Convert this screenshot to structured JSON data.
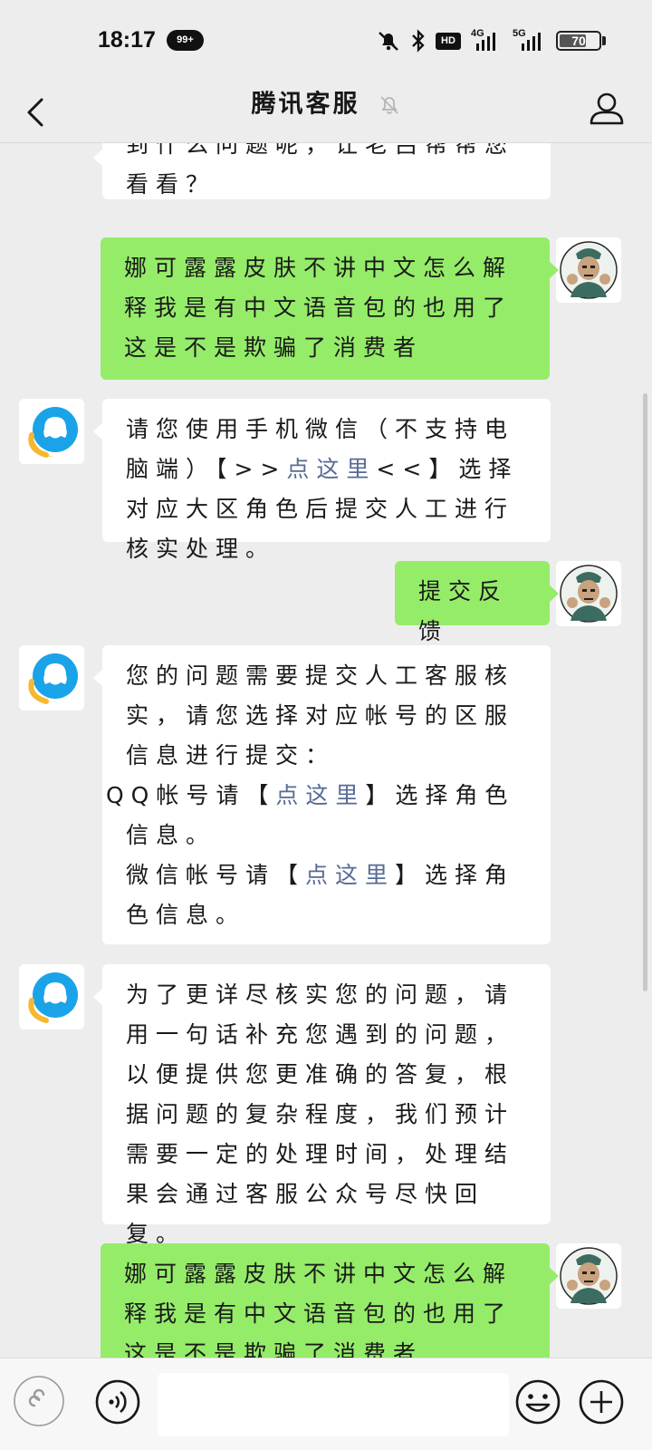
{
  "status_bar": {
    "time": "18:17",
    "notification_badge": "99+",
    "network_hd": "HD",
    "network_4g": "4G",
    "network_5g": "5G",
    "battery": "70",
    "battery_level_percent": 70
  },
  "header": {
    "title": "腾讯客服",
    "icons": {
      "back": "chevron-left-icon",
      "mute": "bell-muted-icon",
      "profile": "person-icon"
    }
  },
  "messages": [
    {
      "from": "service",
      "text": "到什么问题呢，让老吕帮帮您看看？"
    },
    {
      "from": "me",
      "text": "娜可露露皮肤不讲中文怎么解释我是有中文语音包的也用了这是不是欺骗了消费者"
    },
    {
      "from": "service",
      "part1": "请您使用手机微信（不支持电脑端）【>>",
      "link": "点这里",
      "part2": "<<】选择对应大区角色后提交人工进行核实处理。"
    },
    {
      "from": "me",
      "text": "提交反馈"
    },
    {
      "from": "service",
      "intro": "您的问题需要提交人工客服核实，请您选择对应帐号的区服信息进行提交：",
      "qq_prefix": "QQ帐号请【",
      "qq_link": "点这里",
      "qq_suffix": "】选择角色信息。",
      "wx_prefix": "微信帐号请【",
      "wx_link": "点这里",
      "wx_suffix": "】选择角色信息。"
    },
    {
      "from": "service",
      "text": "为了更详尽核实您的问题，请用一句话补充您遇到的问题，以便提供您更准确的答复，根据问题的复杂程度，我们预计需要一定的处理时间，处理结果会通过客服公众号尽快回复。"
    },
    {
      "from": "me",
      "text": "娜可露露皮肤不讲中文怎么解释我是有中文语音包的也用了这是不是欺骗了消费者"
    }
  ],
  "input_bar": {
    "placeholder": "",
    "icons": {
      "mini_program": "mini-program-icon",
      "voice": "voice-icon",
      "emoji": "emoji-icon",
      "add": "plus-icon"
    }
  },
  "colors": {
    "background": "#ededed",
    "outgoing_bubble": "#95ec69",
    "incoming_bubble": "#ffffff",
    "link": "#576b95"
  }
}
